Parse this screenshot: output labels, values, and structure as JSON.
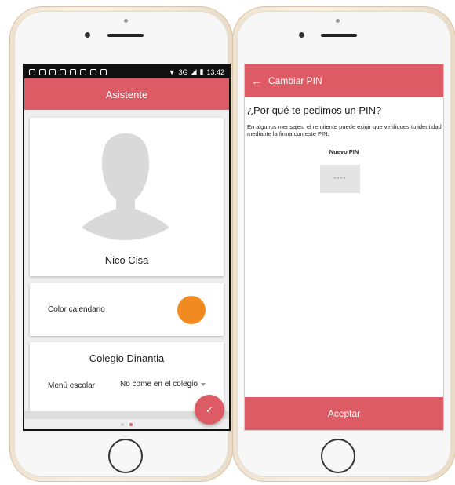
{
  "left_phone": {
    "status": {
      "network": "3G",
      "time": "13:42"
    },
    "app_title": "Asistente",
    "profile": {
      "name": "Nico Cisa"
    },
    "color_setting": {
      "label": "Color calendario",
      "color": "#f28a22"
    },
    "school": {
      "name": "Colegio Dinantia",
      "menu_label": "Menú escolar",
      "menu_value": "No come en el colegio"
    },
    "fab_icon": "check-icon",
    "pager": {
      "total": 2,
      "active": 2
    }
  },
  "right_phone": {
    "title": "Cambiar PIN",
    "question": "¿Por qué te pedimos un PIN?",
    "description": "En algunos mensajes, el remitente puede exigir que verifiques tu identidad mediante la firma con este PIN.",
    "new_pin_label": "Nuevo PIN",
    "pin_placeholder": "****",
    "accept_label": "Aceptar"
  },
  "colors": {
    "accent": "#dd5b65"
  }
}
